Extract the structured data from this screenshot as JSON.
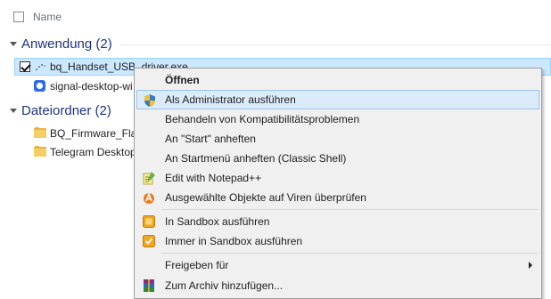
{
  "header": {
    "column_name": "Name"
  },
  "groups": [
    {
      "title": "Anwendung (2)",
      "items": [
        {
          "label": "bq_Handset_USB_driver.exe",
          "checked": true,
          "selected": true
        },
        {
          "label": "signal-desktop-wi"
        }
      ]
    },
    {
      "title": "Dateiordner (2)",
      "items": [
        {
          "label": "BQ_Firmware_Flas"
        },
        {
          "label": "Telegram Desktop"
        }
      ]
    }
  ],
  "context_menu": {
    "items": [
      {
        "label": "Öffnen",
        "bold": true
      },
      {
        "label": "Als Administrator ausführen",
        "icon": "uac-shield-icon",
        "highlighted": true
      },
      {
        "label": "Behandeln von Kompatibilitätsproblemen"
      },
      {
        "label": "An \"Start\" anheften"
      },
      {
        "label": "An Startmenü anheften (Classic Shell)"
      },
      {
        "label": "Edit with Notepad++",
        "icon": "notepad-plus-plus-icon"
      },
      {
        "label": "Ausgewählte Objekte auf Viren überprüfen",
        "icon": "avast-icon"
      },
      {
        "label": "In Sandbox ausführen",
        "icon": "sandbox-icon"
      },
      {
        "label": "Immer in Sandbox ausführen",
        "icon": "sandbox-always-icon"
      },
      {
        "label": "Freigeben für",
        "submenu": true
      },
      {
        "label": "Zum Archiv hinzufügen...",
        "icon": "winrar-icon"
      }
    ]
  },
  "colors": {
    "group_title": "#1e3287",
    "selection_bg": "#cce8ff",
    "menu_bg": "#f0f0f0",
    "menu_highlight": "#dcebfa"
  }
}
